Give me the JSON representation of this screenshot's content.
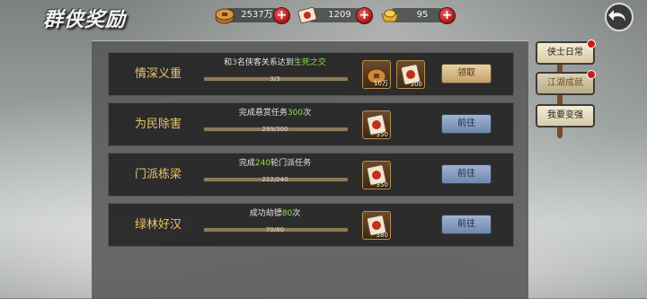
{
  "header": {
    "title": "群侠奖励",
    "resources": [
      {
        "name": "copper-coins",
        "value": "2537万"
      },
      {
        "name": "scroll-token",
        "value": "1209"
      },
      {
        "name": "gold-ingot",
        "value": "95"
      }
    ]
  },
  "side_tabs": [
    {
      "label": "侠士日常",
      "active": false,
      "has_dot": true
    },
    {
      "label": "江湖成就",
      "active": true,
      "has_dot": true
    },
    {
      "label": "我要变强",
      "active": false,
      "has_dot": false
    }
  ],
  "rows": [
    {
      "name": "情深义重",
      "task_pre": "和",
      "task_hl": "3",
      "task_mid": "名侠客关系达到",
      "task_hl2": "生死之交",
      "task_post": "",
      "progress_text": "3/3",
      "progress": 1.0,
      "rewards": [
        {
          "icon": "coin-pouch-icon",
          "qty": "10万"
        },
        {
          "icon": "scroll-token-icon",
          "qty": "300"
        }
      ],
      "button": "领取",
      "button_type": "get"
    },
    {
      "name": "为民除害",
      "task_pre": "完成悬赏任务",
      "task_hl": "300",
      "task_mid": "次",
      "task_hl2": "",
      "task_post": "",
      "progress_text": "299/300",
      "progress": 0.997,
      "rewards": [
        {
          "icon": "scroll-token-icon",
          "qty": "350"
        }
      ],
      "button": "前往",
      "button_type": "go"
    },
    {
      "name": "门派栋梁",
      "task_pre": "完成",
      "task_hl": "240",
      "task_mid": "轮门派任务",
      "task_hl2": "",
      "task_post": "",
      "progress_text": "222/240",
      "progress": 0.925,
      "rewards": [
        {
          "icon": "scroll-token-icon",
          "qty": "350"
        }
      ],
      "button": "前往",
      "button_type": "go"
    },
    {
      "name": "绿林好汉",
      "task_pre": "成功劫镖",
      "task_hl": "80",
      "task_mid": "次",
      "task_hl2": "",
      "task_post": "",
      "progress_text": "70/80",
      "progress": 0.875,
      "rewards": [
        {
          "icon": "scroll-token-icon",
          "qty": "380"
        }
      ],
      "button": "前往",
      "button_type": "go"
    }
  ]
}
